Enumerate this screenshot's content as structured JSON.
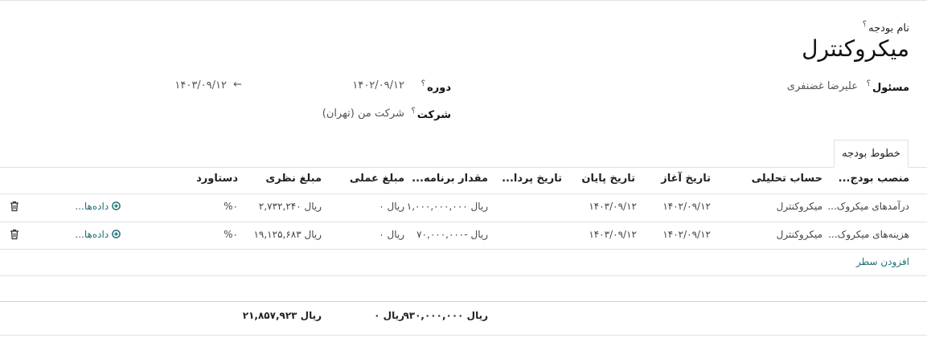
{
  "form": {
    "budget_name_label": "نام بودجه",
    "budget_name_help": "؟",
    "budget_name": "میکروکنترل",
    "responsible_label": "مسئول",
    "responsible_help": "؟",
    "responsible_value": "علیرضا غضنفری",
    "period_label": "دوره",
    "period_help": "؟",
    "period_start": "۱۴۰۲/۰۹/۱۲",
    "period_arrow": "←",
    "period_end": "۱۴۰۳/۰۹/۱۲",
    "company_label": "شرکت",
    "company_help": "؟",
    "company_value": "شرکت من (تهران)"
  },
  "tabs": [
    {
      "label": "خطوط بودجه",
      "active": true
    }
  ],
  "table": {
    "headers": {
      "position": "منصب بودج...",
      "analytic": "حساب تحلیلی",
      "start": "تاریخ آغاز",
      "end": "تاریخ پایان",
      "paid_date": "تاریخ پردا...",
      "planned": "مقدار برنامه...",
      "practical": "مبلغ عملی",
      "theoretical": "مبلغ نظری",
      "achievement": "دستاورد"
    },
    "rows": [
      {
        "position": "درآمدهای میکروک...",
        "analytic": "میکروکنترل",
        "start": "۱۴۰۲/۰۹/۱۲",
        "end": "۱۴۰۳/۰۹/۱۲",
        "paid_date": "",
        "planned": "ریال ۱,۰۰۰,۰۰۰,۰۰۰",
        "practical": "ریال ۰",
        "theoretical": "ریال ۲,۷۳۲,۲۴۰",
        "achievement": "%۰",
        "details": "داده‌ها..."
      },
      {
        "position": "هزینه‌های میکروک...",
        "analytic": "میکروکنترل",
        "start": "۱۴۰۲/۰۹/۱۲",
        "end": "۱۴۰۳/۰۹/۱۲",
        "paid_date": "",
        "planned": "ریال -۷۰,۰۰۰,۰۰۰",
        "practical": "ریال ۰",
        "theoretical": "ریال ۱۹,۱۲۵,۶۸۳",
        "achievement": "%۰",
        "details": "داده‌ها..."
      }
    ],
    "add_line": "افزودن سطر",
    "totals": {
      "planned": "ریال ۹۳۰,۰۰۰,۰۰۰",
      "practical": "ریال ۰",
      "theoretical": "ریال ۲۱,۸۵۷,۹۲۳"
    }
  },
  "icons": {
    "trash": "trash-icon",
    "details": "plus-circle-icon",
    "arrow": "arrow-left-icon"
  },
  "colors": {
    "link": "#1b6f76",
    "border": "#dee2e6"
  }
}
